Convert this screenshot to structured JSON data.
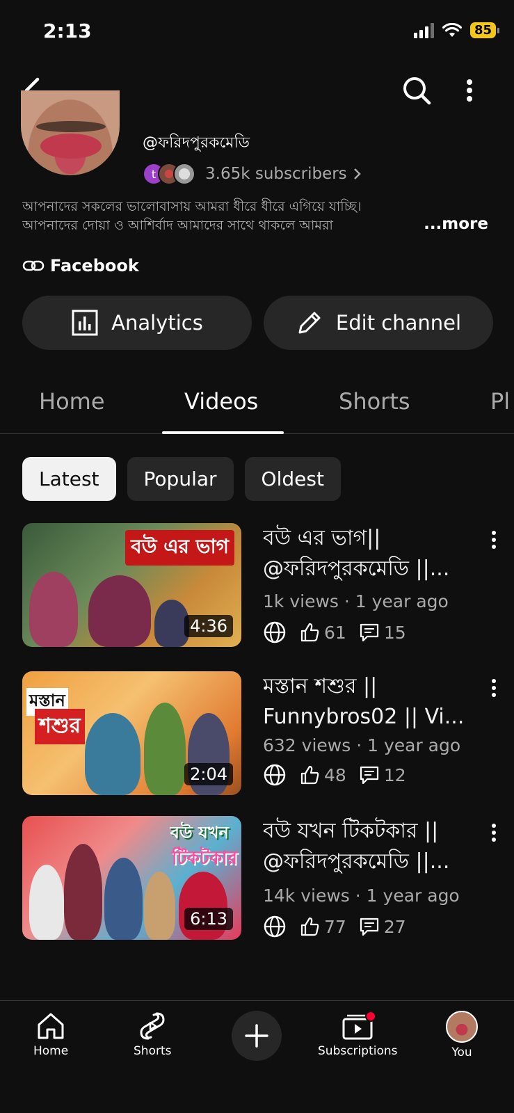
{
  "status": {
    "time": "2:13",
    "battery": "85"
  },
  "channel": {
    "handle": "@ফরিদপুরকমেডি",
    "subscribers": "3.65k subscribers",
    "mini_avatar_letter": "t",
    "description_lines": [
      "আপনাদের সকলের ভালোবাসায় আমরা ধীরে ধীরে এগিয়ে যাচ্ছি।",
      "আপনাদের দোয়া ও আশির্বাদ আমাদের সাথে থাকলে আমরা"
    ],
    "more_label": "...more",
    "link_label": "Facebook"
  },
  "buttons": {
    "analytics": "Analytics",
    "edit_channel": "Edit channel"
  },
  "tabs": [
    "Home",
    "Videos",
    "Shorts",
    "Pl"
  ],
  "chips": [
    "Latest",
    "Popular",
    "Oldest"
  ],
  "videos": [
    {
      "title": "বউ এর ভাগ|| @ফরিদপুরকমেডি ||...",
      "thumb_text": "বউ এর ভাগ",
      "duration": "4:36",
      "meta": "1k views · 1 year ago",
      "likes": "61",
      "comments": "15"
    },
    {
      "title": "মস্তান শশুর || Funnybros02 || Vi...",
      "thumb_text_1": "মস্তান",
      "thumb_text_2": "শশুর",
      "duration": "2:04",
      "meta": "632 views · 1 year ago",
      "likes": "48",
      "comments": "12"
    },
    {
      "title": "বউ যখন টিকটকার || @ফরিদপুরকমেডি ||...",
      "thumb_text_1": "বউ যখন",
      "thumb_text_2": "টিকটকার",
      "duration": "6:13",
      "meta": "14k views · 1 year ago",
      "likes": "77",
      "comments": "27"
    }
  ],
  "bottom_nav": {
    "home": "Home",
    "shorts": "Shorts",
    "subscriptions": "Subscriptions",
    "you": "You"
  }
}
